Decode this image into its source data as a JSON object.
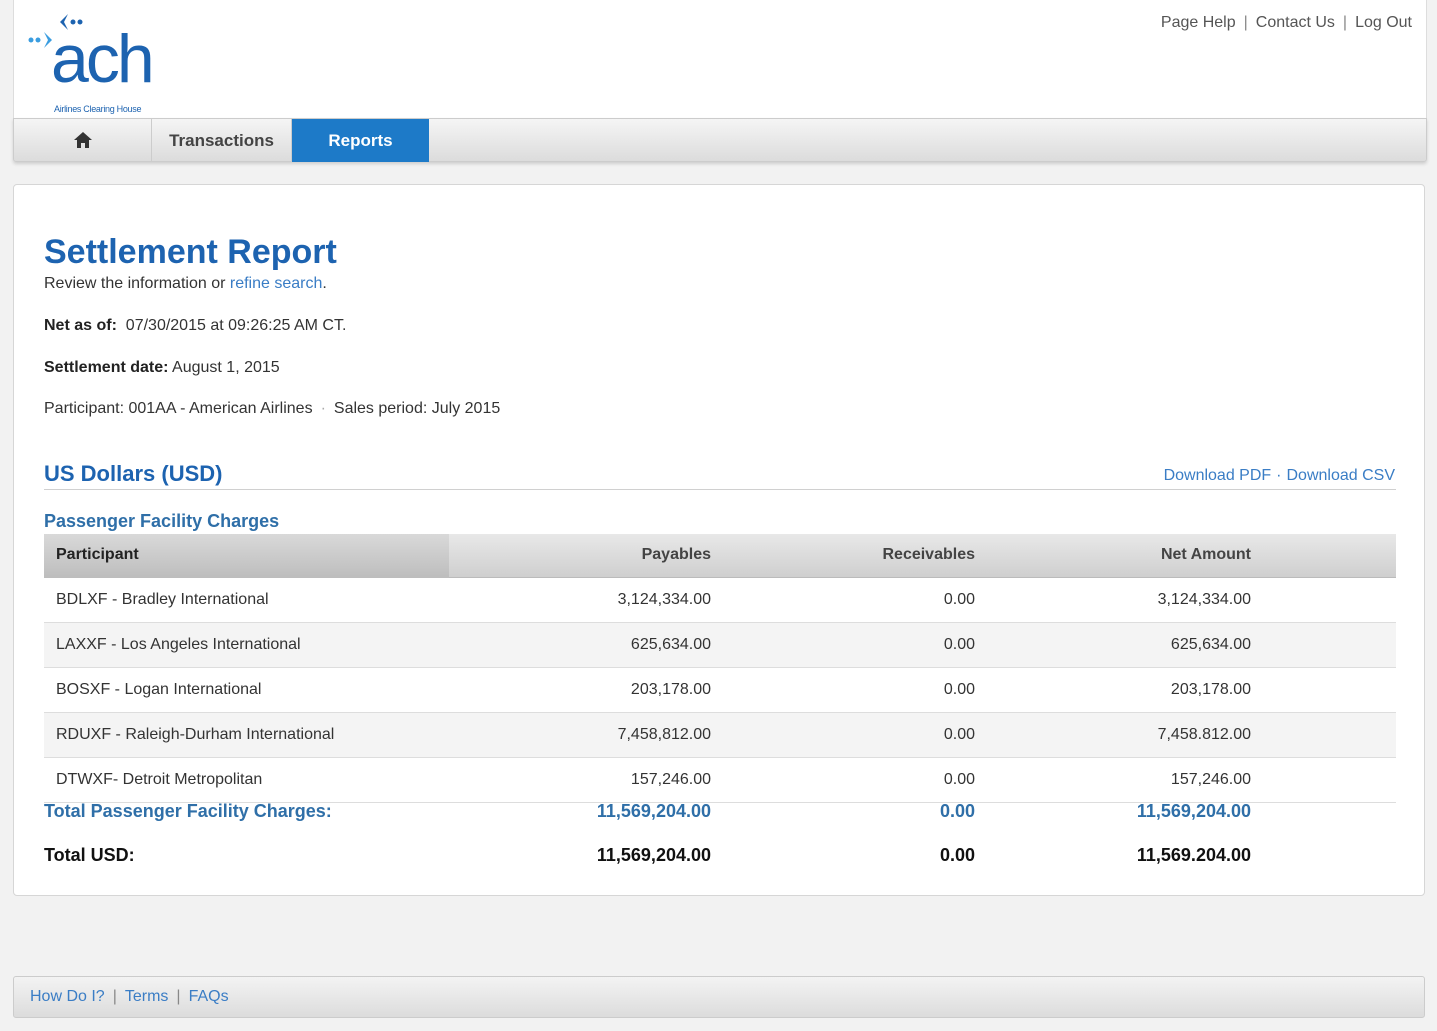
{
  "header": {
    "logo_text": "ach",
    "logo_sub": "Airlines Clearing House",
    "links": [
      "Page Help",
      "Contact Us",
      "Log Out"
    ]
  },
  "nav": {
    "home_icon": "home-icon",
    "items": [
      "Transactions",
      "Reports"
    ],
    "active": "Reports"
  },
  "report": {
    "title": "Settlement Report",
    "subtitle_prefix": "Review the information or",
    "subtitle_link": "refine search",
    "subtitle_suffix": ".",
    "net_label": "Net as of:",
    "net_value": "07/30/2015 at 09:26:25 AM CT.",
    "settlement_label": "Settlement date:",
    "settlement_value": "August 1, 2015",
    "participant": "Participant: 001AA - American Airlines",
    "sales_period": "Sales period: July 2015"
  },
  "section": {
    "title": "US Dollars (USD)",
    "download_pdf": "Download PDF",
    "download_csv": "Download CSV",
    "subsection": "Passenger Facility Charges"
  },
  "table": {
    "headers": [
      "Participant",
      "Payables",
      "Receivables",
      "Net Amount"
    ],
    "rows": [
      [
        "BDLXF - Bradley International",
        "3,124,334.00",
        "0.00",
        "3,124,334.00"
      ],
      [
        "LAXXF - Los Angeles International",
        "625,634.00",
        "0.00",
        "625,634.00"
      ],
      [
        "BOSXF - Logan International",
        "203,178.00",
        "0.00",
        "203,178.00"
      ],
      [
        "RDUXF - Raleigh-Durham International",
        "7,458,812.00",
        "0.00",
        "7,458.812.00"
      ],
      [
        "DTWXF- Detroit Metropolitan",
        "157,246.00",
        "0.00",
        "157,246.00"
      ]
    ],
    "total_pfc": [
      "Total Passenger Facility Charges:",
      "11,569,204.00",
      "0.00",
      "11,569,204.00"
    ],
    "total_usd": [
      "Total USD:",
      "11,569,204.00",
      "0.00",
      "11,569.204.00"
    ]
  },
  "footer": {
    "links": [
      "How Do I?",
      "Terms",
      "FAQs"
    ]
  }
}
